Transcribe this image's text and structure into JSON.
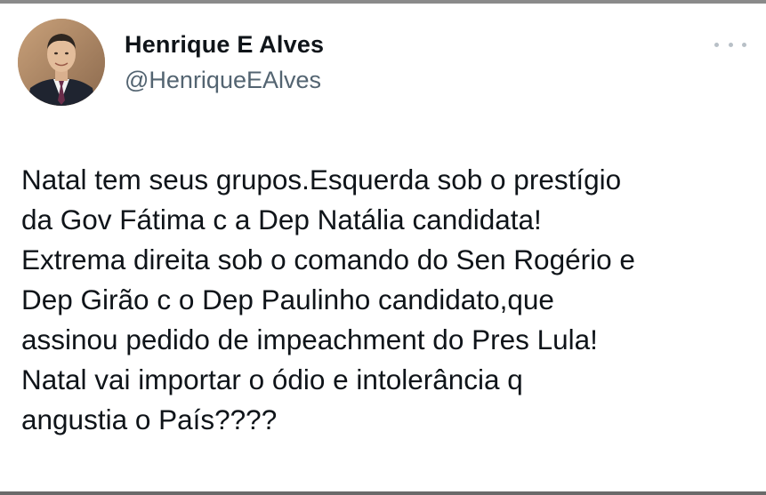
{
  "author": {
    "display_name": "Henrique E Alves",
    "handle": "@HenriqueEAlves"
  },
  "menu": {
    "icon": "more-horizontal-icon"
  },
  "tweet": {
    "text": "Natal tem seus grupos.Esquerda sob o prestígio\nda Gov Fátima c a Dep Natália candidata!\nExtrema direita sob o comando do Sen Rogério e\nDep Girão c o Dep Paulinho candidato,que\nassinou pedido de impeachment do Pres Lula!\nNatal vai importar o ódio e intolerância q\nangustia o País????"
  },
  "colors": {
    "text_primary": "#0f1419",
    "text_secondary": "#536471",
    "icon_muted": "#b8c0c7"
  }
}
